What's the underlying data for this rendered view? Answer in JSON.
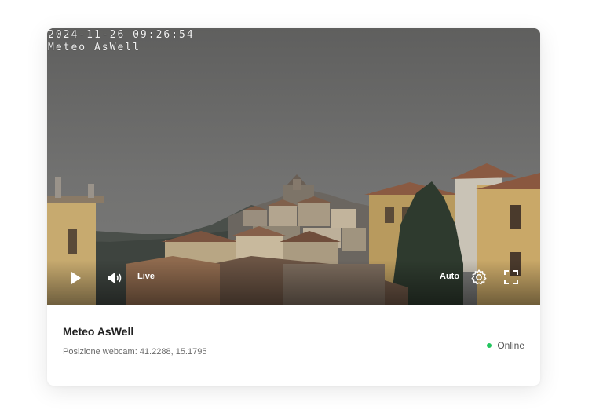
{
  "camera": {
    "timestamp": "2024-11-26 09:26:54",
    "watermark": "Meteo AsWell",
    "title": "Meteo AsWell",
    "position": "Posizione webcam: 41.2288, 15.1795",
    "status": "Online"
  },
  "controls": {
    "live_label": "Live",
    "quality_label": "Auto",
    "play_icon": "play-icon",
    "volume_icon": "volume-icon",
    "settings_icon": "gear-icon",
    "fullscreen_icon": "fullscreen-icon"
  },
  "colors": {
    "status_online": "#22c55e",
    "sky": "#6e6e6c"
  }
}
